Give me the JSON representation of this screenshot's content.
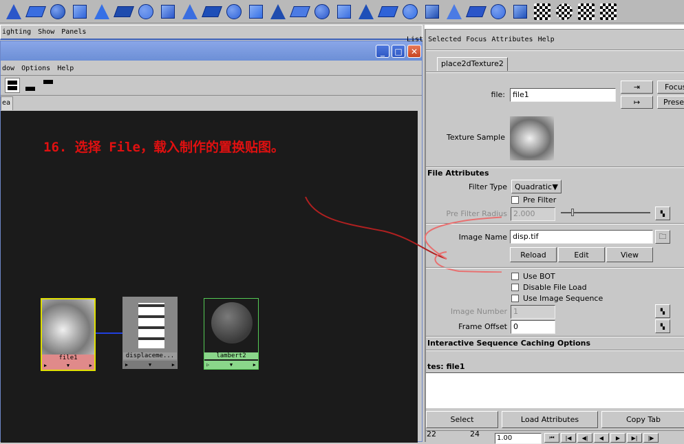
{
  "shelf": {
    "icons": [
      "cone-icon",
      "plane-icon",
      "disk-icon",
      "pyramid-icon",
      "cylinder-icon",
      "helix-icon",
      "dial-icon",
      "lattice-icon",
      "deform-icon",
      "sphere-deform-icon",
      "cube-icon",
      "plane-deform-icon",
      "bend-icon",
      "cube-select-icon",
      "cube-edit-icon",
      "panel-icon",
      "wedge-icon",
      "subdiv-icon",
      "lattice-plane-icon",
      "bevel-icon",
      "extrude-icon",
      "split-icon",
      "patch-icon",
      "pivot-icon",
      "checker-node-icon",
      "checker-sphere-icon",
      "checker-flag-icon",
      "checker-grid-icon"
    ]
  },
  "main_menu": [
    "ighting",
    "Show",
    "Panels"
  ],
  "hypershade": {
    "menu": [
      "dow",
      "Options",
      "Help"
    ],
    "tab": "ea",
    "annotation": "16. 选择 File，载入制作的置换贴图。",
    "nodes": [
      {
        "label": "file1",
        "color": "#e08a8a"
      },
      {
        "label": "displaceme...",
        "color": "#8d8d8d"
      },
      {
        "label": "lambert2",
        "color": "#8ad68a"
      }
    ]
  },
  "ae": {
    "menu": [
      "List",
      "Selected",
      "Focus",
      "Attributes",
      "Help"
    ],
    "tab": "place2dTexture2",
    "file_label": "file:",
    "file_value": "file1",
    "focus_btn": "Focus",
    "presets_btn": "Presets",
    "texture_sample": "Texture Sample",
    "section_file": "File Attributes",
    "filter_type_label": "Filter Type",
    "filter_type_value": "Quadratic",
    "pre_filter": "Pre Filter",
    "pre_filter_radius_label": "Pre Filter Radius",
    "pre_filter_radius_value": "2.000",
    "image_name_label": "Image Name",
    "image_name_value": "disp.tif",
    "reload": "Reload",
    "edit": "Edit",
    "view": "View",
    "use_bot": "Use BOT",
    "disable_file_load": "Disable File Load",
    "use_image_sequence": "Use Image Sequence",
    "image_number_label": "Image Number",
    "image_number_value": "1",
    "frame_offset_label": "Frame Offset",
    "frame_offset_value": "0",
    "section_interactive": "Interactive Sequence Caching Options",
    "notes_label": "tes: file1",
    "select_btn": "Select",
    "load_attr_btn": "Load Attributes",
    "copy_tab_btn": "Copy Tab"
  },
  "timeline": {
    "start": "22",
    "end": "24",
    "current": "1.00"
  },
  "colors": {
    "annotation": "#e01010",
    "circle": "#e87070",
    "graph_bg": "#1b1b1b"
  }
}
